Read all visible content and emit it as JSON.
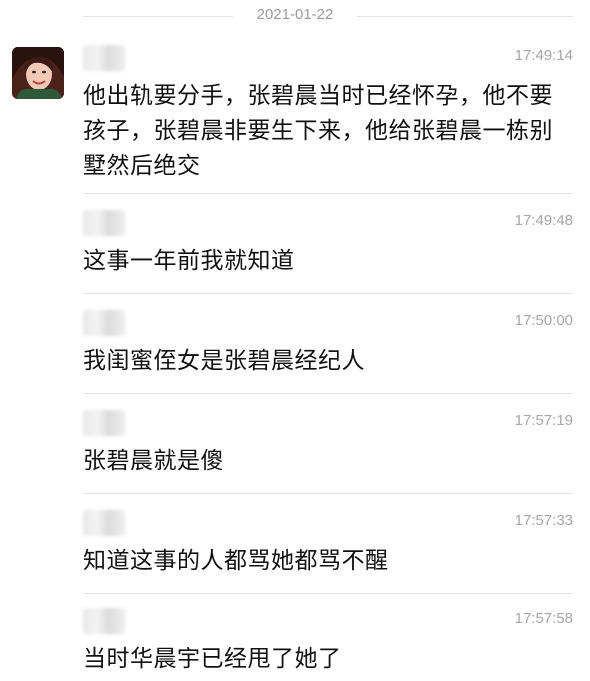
{
  "date_divider": "2021-01-22",
  "messages": [
    {
      "time": "17:49:14",
      "text": "他出轨要分手，张碧晨当时已经怀孕，他不要孩子，张碧晨非要生下来，他给张碧晨一栋别墅然后绝交"
    },
    {
      "time": "17:49:48",
      "text": "这事一年前我就知道"
    },
    {
      "time": "17:50:00",
      "text": "我闺蜜侄女是张碧晨经纪人"
    },
    {
      "time": "17:57:19",
      "text": "张碧晨就是傻"
    },
    {
      "time": "17:57:33",
      "text": "知道这事的人都骂她都骂不醒"
    },
    {
      "time": "17:57:58",
      "text": "当时华晨宇已经甩了她了"
    }
  ]
}
